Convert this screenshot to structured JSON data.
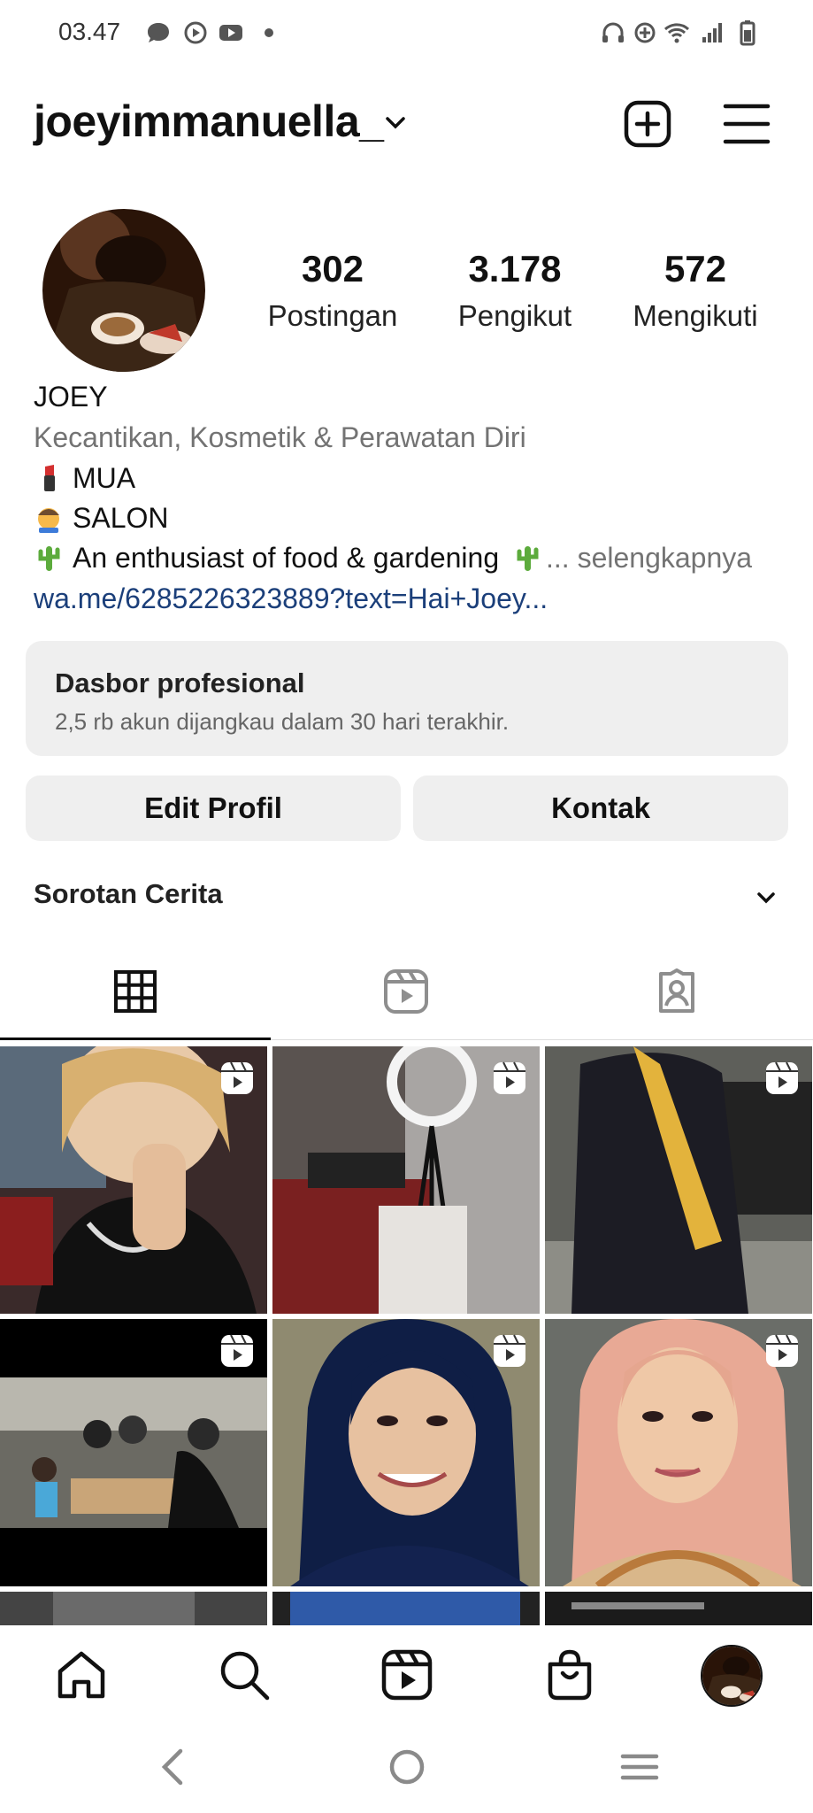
{
  "status_bar": {
    "time": "03.47"
  },
  "header": {
    "username": "joeyimmanuella_"
  },
  "profile": {
    "stats": [
      {
        "value": "302",
        "label": "Postingan"
      },
      {
        "value": "3.178",
        "label": "Pengikut"
      },
      {
        "value": "572",
        "label": "Mengikuti"
      }
    ],
    "name": "JOEY",
    "category": "Kecantikan, Kosmetik & Perawatan Diri",
    "bio_line1": "MUA",
    "bio_line2": "SALON",
    "bio_line3": "An enthusiast of food & gardening",
    "more": "... selengkapnya",
    "link": "wa.me/6285226323889?text=Hai+Joey..."
  },
  "dashboard": {
    "title": "Dasbor profesional",
    "subtitle": "2,5 rb akun dijangkau dalam 30 hari terakhir."
  },
  "buttons": {
    "edit": "Edit Profil",
    "contact": "Kontak"
  },
  "highlights": {
    "label": "Sorotan Cerita"
  },
  "tabs": [
    "grid-icon",
    "reels-icon",
    "tagged-icon"
  ],
  "colors": {
    "accent_link": "#1b3f7a",
    "button_bg": "#efefef"
  }
}
